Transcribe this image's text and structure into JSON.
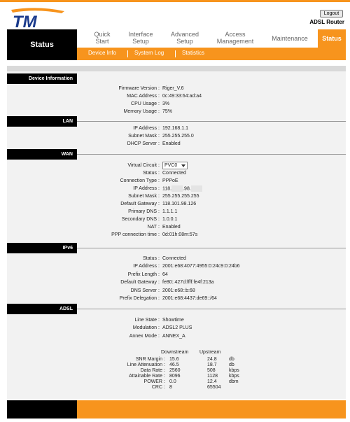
{
  "header": {
    "logo_text": "TM",
    "logout_label": "Logout",
    "product_name": "ADSL Router",
    "brand_color": "#f7941d"
  },
  "nav": {
    "current_section": "Status",
    "items": [
      {
        "label": "Quick Start",
        "line1": "Quick",
        "line2": "Start"
      },
      {
        "label": "Interface Setup",
        "line1": "Interface",
        "line2": "Setup"
      },
      {
        "label": "Advanced Setup",
        "line1": "Advanced",
        "line2": "Setup"
      },
      {
        "label": "Access Management",
        "line1": "Access",
        "line2": "Management"
      },
      {
        "label": "Maintenance",
        "line1": "Maintenance",
        "line2": ""
      },
      {
        "label": "Status",
        "line1": "Status",
        "line2": "",
        "active": true
      }
    ],
    "subitems": [
      "Device Info",
      "System Log",
      "Statistics"
    ]
  },
  "device_info": {
    "title": "Device Information",
    "rows": [
      {
        "label": "Firmware Version",
        "value": "Riger_V.6"
      },
      {
        "label": "MAC Address",
        "value": "0c:49:33:64:ad:a4"
      },
      {
        "label": "CPU Usage",
        "value": "3%"
      },
      {
        "label": "Memory Usage",
        "value": "75%"
      }
    ]
  },
  "lan": {
    "title": "LAN",
    "rows": [
      {
        "label": "IP Address",
        "value": "192.168.1.1"
      },
      {
        "label": "Subnet Mask",
        "value": "255.255.255.0"
      },
      {
        "label": "DHCP Server",
        "value": "Enabled"
      }
    ]
  },
  "wan": {
    "title": "WAN",
    "virtual_circuit_label": "Virtual Circuit",
    "virtual_circuit_value": "PVC0",
    "ip_part1": "118.",
    "ip_part2": ".98.",
    "rows": [
      {
        "label": "Status",
        "value": "Connected"
      },
      {
        "label": "Connection Type",
        "value": "PPPoE"
      },
      {
        "label": "IP Address",
        "value": ""
      },
      {
        "label": "Subnet Mask",
        "value": "255.255.255.255"
      },
      {
        "label": "Default Gateway",
        "value": "118.101.98.126"
      },
      {
        "label": "Primary DNS",
        "value": "1.1.1.1"
      },
      {
        "label": "Secondary DNS",
        "value": "1.0.0.1"
      },
      {
        "label": "NAT",
        "value": "Enabled"
      },
      {
        "label": "PPP connection time",
        "value": "0d:01h:08m:57s"
      }
    ]
  },
  "ipv6": {
    "title": "IPv6",
    "rows": [
      {
        "label": "Status",
        "value": "Connected"
      },
      {
        "label": "IP Address",
        "value": "2001:e68:4077:4955:0:24c9:0:24b6"
      },
      {
        "label": "Prefix Length",
        "value": "64"
      },
      {
        "label": "Default Gateway",
        "value": "fe80::427d:ffff:fe4f:213a"
      },
      {
        "label": "DNS Server",
        "value": "2001:e68::b:68"
      },
      {
        "label": "Prefix Delegation",
        "value": "2001:e68:4437:de69::/64"
      }
    ]
  },
  "adsl": {
    "title": "ADSL",
    "rows": [
      {
        "label": "Line State",
        "value": "Showtime"
      },
      {
        "label": "Modulation",
        "value": "ADSL2 PLUS"
      },
      {
        "label": "Annex Mode",
        "value": "ANNEX_A"
      }
    ],
    "stats_headers": {
      "downstream": "Downstream",
      "upstream": "Upstream"
    },
    "stats": [
      {
        "label": "SNR Margin",
        "down": "15.6",
        "up": "24.8",
        "unit": "db"
      },
      {
        "label": "Line Attenuation",
        "down": "46.5",
        "up": "18.7",
        "unit": "db"
      },
      {
        "label": "Data Rate",
        "down": "2560",
        "up": "508",
        "unit": "kbps"
      },
      {
        "label": "Attainable Rate",
        "down": "8096",
        "up": "1128",
        "unit": "kbps"
      },
      {
        "label": "POWER",
        "down": "0.0",
        "up": "12.4",
        "unit": "dbm"
      },
      {
        "label": "CRC",
        "down": "8",
        "up": "65504",
        "unit": ""
      }
    ]
  }
}
